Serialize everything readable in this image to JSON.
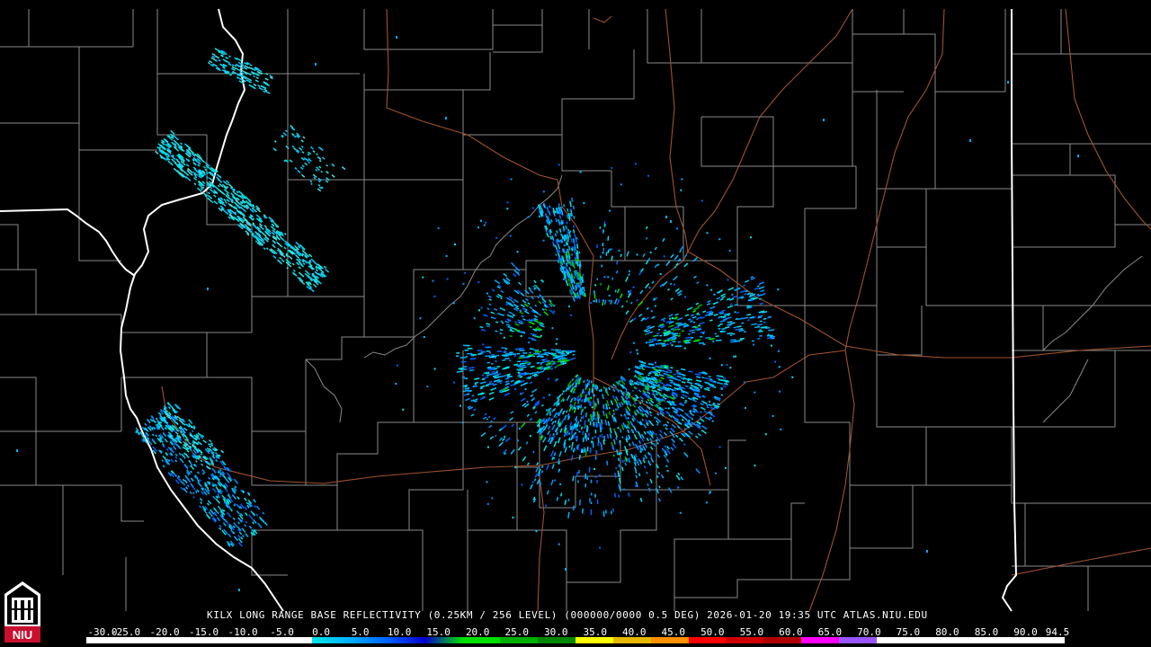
{
  "product": {
    "caption": "KILX LONG RANGE BASE REFLECTIVITY (0.25KM / 256 LEVEL) (000000/0000 0.5 DEG) 2026-01-20 19:35 UTC  ATLAS.NIU.EDU",
    "logo_text": "NIU"
  },
  "colorscale": {
    "labels": [
      "-30.0",
      "-25.0",
      "-20.0",
      "-15.0",
      "-10.0",
      "-5.0",
      "0.0",
      "5.0",
      "10.0",
      "15.0",
      "20.0",
      "25.0",
      "30.0",
      "35.0",
      "40.0",
      "45.0",
      "50.0",
      "55.0",
      "60.0",
      "65.0",
      "70.0",
      "75.0",
      "80.0",
      "85.0",
      "90.0",
      "94.5"
    ],
    "colors": [
      "#ffffff",
      "#ffffff",
      "#ffffff",
      "#ffffff",
      "#ffffff",
      "#ffffff",
      "#00e5e5",
      "#00b0ff",
      "#0060ff",
      "#0000d0",
      "#00e000",
      "#00b000",
      "#008800",
      "#ffff00",
      "#e6b800",
      "#ff9000",
      "#ff0000",
      "#d00000",
      "#b00000",
      "#ff00ff",
      "#9955ff",
      "#ffffff",
      "#ffffff",
      "#ffffff",
      "#ffffff",
      "#ffffff"
    ]
  },
  "colors": {
    "county_lines": "#8a8a8a",
    "state_lines": "#ffffff",
    "highways": "#a0522d",
    "background": "#000000"
  },
  "radar_site": "KILX"
}
